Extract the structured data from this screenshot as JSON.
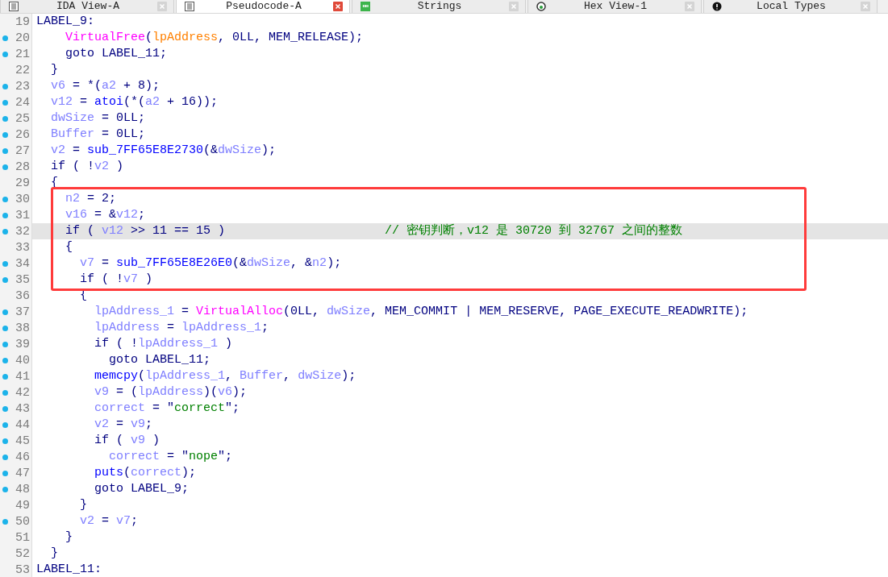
{
  "tabs": [
    {
      "label": "IDA View-A",
      "selected": false
    },
    {
      "label": "Pseudocode-A",
      "selected": true
    },
    {
      "label": "Strings",
      "selected": false
    },
    {
      "label": "Hex View-1",
      "selected": false
    },
    {
      "label": "Local Types",
      "selected": false
    }
  ],
  "code": {
    "lines": [
      {
        "number": "19",
        "breakpoint": false,
        "highlighted": false,
        "segments": [
          {
            "kind": "plain",
            "text": "LABEL_9:"
          }
        ]
      },
      {
        "number": "20",
        "breakpoint": true,
        "highlighted": false,
        "segments": [
          {
            "kind": "import",
            "text": "    VirtualFree"
          },
          {
            "kind": "plain",
            "text": "("
          },
          {
            "kind": "arg",
            "text": "lpAddress"
          },
          {
            "kind": "plain",
            "text": ", 0LL, MEM_RELEASE);"
          }
        ]
      },
      {
        "number": "21",
        "breakpoint": true,
        "highlighted": false,
        "segments": [
          {
            "kind": "plain",
            "text": "    goto LABEL_11;"
          }
        ]
      },
      {
        "number": "22",
        "breakpoint": false,
        "highlighted": false,
        "segments": [
          {
            "kind": "plain",
            "text": "  }"
          }
        ]
      },
      {
        "number": "23",
        "breakpoint": true,
        "highlighted": false,
        "segments": [
          {
            "kind": "var",
            "text": "  v6"
          },
          {
            "kind": "plain",
            "text": " = *("
          },
          {
            "kind": "var",
            "text": "a2"
          },
          {
            "kind": "plain",
            "text": " + 8);"
          }
        ]
      },
      {
        "number": "24",
        "breakpoint": true,
        "highlighted": false,
        "segments": [
          {
            "kind": "var",
            "text": "  v12"
          },
          {
            "kind": "plain",
            "text": " = "
          },
          {
            "kind": "func",
            "text": "atoi"
          },
          {
            "kind": "plain",
            "text": "(*("
          },
          {
            "kind": "var",
            "text": "a2"
          },
          {
            "kind": "plain",
            "text": " + 16));"
          }
        ]
      },
      {
        "number": "25",
        "breakpoint": true,
        "highlighted": false,
        "segments": [
          {
            "kind": "var",
            "text": "  dwSize"
          },
          {
            "kind": "plain",
            "text": " = 0LL;"
          }
        ]
      },
      {
        "number": "26",
        "breakpoint": true,
        "highlighted": false,
        "segments": [
          {
            "kind": "var",
            "text": "  Buffer"
          },
          {
            "kind": "plain",
            "text": " = 0LL;"
          }
        ]
      },
      {
        "number": "27",
        "breakpoint": true,
        "highlighted": false,
        "segments": [
          {
            "kind": "var",
            "text": "  v2"
          },
          {
            "kind": "plain",
            "text": " = "
          },
          {
            "kind": "func",
            "text": "sub_7FF65E8E2730"
          },
          {
            "kind": "plain",
            "text": "(&"
          },
          {
            "kind": "var",
            "text": "dwSize"
          },
          {
            "kind": "plain",
            "text": ");"
          }
        ]
      },
      {
        "number": "28",
        "breakpoint": true,
        "highlighted": false,
        "segments": [
          {
            "kind": "plain",
            "text": "  if ( !"
          },
          {
            "kind": "var",
            "text": "v2"
          },
          {
            "kind": "plain",
            "text": " )"
          }
        ]
      },
      {
        "number": "29",
        "breakpoint": false,
        "highlighted": false,
        "segments": [
          {
            "kind": "plain",
            "text": "  {"
          }
        ]
      },
      {
        "number": "30",
        "breakpoint": true,
        "highlighted": false,
        "segments": [
          {
            "kind": "var",
            "text": "    n2"
          },
          {
            "kind": "plain",
            "text": " = 2;"
          }
        ]
      },
      {
        "number": "31",
        "breakpoint": true,
        "highlighted": false,
        "segments": [
          {
            "kind": "var",
            "text": "    v16"
          },
          {
            "kind": "plain",
            "text": " = &"
          },
          {
            "kind": "var",
            "text": "v12"
          },
          {
            "kind": "plain",
            "text": ";"
          }
        ]
      },
      {
        "number": "32",
        "breakpoint": true,
        "highlighted": true,
        "segments": [
          {
            "kind": "plain",
            "text": "    if ( "
          },
          {
            "kind": "var",
            "text": "v12"
          },
          {
            "kind": "plain",
            "text": " >> 11 == 15 )                      "
          },
          {
            "kind": "comment",
            "text": "// 密钥判断，v12 是 30720 到 32767 之间的整数"
          }
        ]
      },
      {
        "number": "33",
        "breakpoint": false,
        "highlighted": false,
        "segments": [
          {
            "kind": "plain",
            "text": "    {"
          }
        ]
      },
      {
        "number": "34",
        "breakpoint": true,
        "highlighted": false,
        "segments": [
          {
            "kind": "var",
            "text": "      v7"
          },
          {
            "kind": "plain",
            "text": " = "
          },
          {
            "kind": "func",
            "text": "sub_7FF65E8E26E0"
          },
          {
            "kind": "plain",
            "text": "(&"
          },
          {
            "kind": "var",
            "text": "dwSize"
          },
          {
            "kind": "plain",
            "text": ", &"
          },
          {
            "kind": "var",
            "text": "n2"
          },
          {
            "kind": "plain",
            "text": ");"
          }
        ]
      },
      {
        "number": "35",
        "breakpoint": true,
        "highlighted": false,
        "segments": [
          {
            "kind": "plain",
            "text": "      if ( !"
          },
          {
            "kind": "var",
            "text": "v7"
          },
          {
            "kind": "plain",
            "text": " )"
          }
        ]
      },
      {
        "number": "36",
        "breakpoint": false,
        "highlighted": false,
        "segments": [
          {
            "kind": "plain",
            "text": "      {"
          }
        ]
      },
      {
        "number": "37",
        "breakpoint": true,
        "highlighted": false,
        "segments": [
          {
            "kind": "var",
            "text": "        lpAddress_1"
          },
          {
            "kind": "plain",
            "text": " = "
          },
          {
            "kind": "import",
            "text": "VirtualAlloc"
          },
          {
            "kind": "plain",
            "text": "(0LL, "
          },
          {
            "kind": "var",
            "text": "dwSize"
          },
          {
            "kind": "plain",
            "text": ", MEM_COMMIT | MEM_RESERVE, PAGE_EXECUTE_READWRITE);"
          }
        ]
      },
      {
        "number": "38",
        "breakpoint": true,
        "highlighted": false,
        "segments": [
          {
            "kind": "var",
            "text": "        lpAddress"
          },
          {
            "kind": "plain",
            "text": " = "
          },
          {
            "kind": "var",
            "text": "lpAddress_1"
          },
          {
            "kind": "plain",
            "text": ";"
          }
        ]
      },
      {
        "number": "39",
        "breakpoint": true,
        "highlighted": false,
        "segments": [
          {
            "kind": "plain",
            "text": "        if ( !"
          },
          {
            "kind": "var",
            "text": "lpAddress_1"
          },
          {
            "kind": "plain",
            "text": " )"
          }
        ]
      },
      {
        "number": "40",
        "breakpoint": true,
        "highlighted": false,
        "segments": [
          {
            "kind": "plain",
            "text": "          goto LABEL_11;"
          }
        ]
      },
      {
        "number": "41",
        "breakpoint": true,
        "highlighted": false,
        "segments": [
          {
            "kind": "func",
            "text": "        memcpy"
          },
          {
            "kind": "plain",
            "text": "("
          },
          {
            "kind": "var",
            "text": "lpAddress_1"
          },
          {
            "kind": "plain",
            "text": ", "
          },
          {
            "kind": "var",
            "text": "Buffer"
          },
          {
            "kind": "plain",
            "text": ", "
          },
          {
            "kind": "var",
            "text": "dwSize"
          },
          {
            "kind": "plain",
            "text": ");"
          }
        ]
      },
      {
        "number": "42",
        "breakpoint": true,
        "highlighted": false,
        "segments": [
          {
            "kind": "var",
            "text": "        v9"
          },
          {
            "kind": "plain",
            "text": " = ("
          },
          {
            "kind": "var",
            "text": "lpAddress"
          },
          {
            "kind": "plain",
            "text": ")("
          },
          {
            "kind": "var",
            "text": "v6"
          },
          {
            "kind": "plain",
            "text": ");"
          }
        ]
      },
      {
        "number": "43",
        "breakpoint": true,
        "highlighted": false,
        "segments": [
          {
            "kind": "var",
            "text": "        correct"
          },
          {
            "kind": "plain",
            "text": " = \""
          },
          {
            "kind": "string",
            "text": "correct"
          },
          {
            "kind": "plain",
            "text": "\";"
          }
        ]
      },
      {
        "number": "44",
        "breakpoint": true,
        "highlighted": false,
        "segments": [
          {
            "kind": "var",
            "text": "        v2"
          },
          {
            "kind": "plain",
            "text": " = "
          },
          {
            "kind": "var",
            "text": "v9"
          },
          {
            "kind": "plain",
            "text": ";"
          }
        ]
      },
      {
        "number": "45",
        "breakpoint": true,
        "highlighted": false,
        "segments": [
          {
            "kind": "plain",
            "text": "        if ( "
          },
          {
            "kind": "var",
            "text": "v9"
          },
          {
            "kind": "plain",
            "text": " )"
          }
        ]
      },
      {
        "number": "46",
        "breakpoint": true,
        "highlighted": false,
        "segments": [
          {
            "kind": "var",
            "text": "          correct"
          },
          {
            "kind": "plain",
            "text": " = \""
          },
          {
            "kind": "string",
            "text": "nope"
          },
          {
            "kind": "plain",
            "text": "\";"
          }
        ]
      },
      {
        "number": "47",
        "breakpoint": true,
        "highlighted": false,
        "segments": [
          {
            "kind": "func",
            "text": "        puts"
          },
          {
            "kind": "plain",
            "text": "("
          },
          {
            "kind": "var",
            "text": "correct"
          },
          {
            "kind": "plain",
            "text": ");"
          }
        ]
      },
      {
        "number": "48",
        "breakpoint": true,
        "highlighted": false,
        "segments": [
          {
            "kind": "plain",
            "text": "        goto LABEL_9;"
          }
        ]
      },
      {
        "number": "49",
        "breakpoint": false,
        "highlighted": false,
        "segments": [
          {
            "kind": "plain",
            "text": "      }"
          }
        ]
      },
      {
        "number": "50",
        "breakpoint": true,
        "highlighted": false,
        "segments": [
          {
            "kind": "var",
            "text": "      v2"
          },
          {
            "kind": "plain",
            "text": " = "
          },
          {
            "kind": "var",
            "text": "v7"
          },
          {
            "kind": "plain",
            "text": ";"
          }
        ]
      },
      {
        "number": "51",
        "breakpoint": false,
        "highlighted": false,
        "segments": [
          {
            "kind": "plain",
            "text": "    }"
          }
        ]
      },
      {
        "number": "52",
        "breakpoint": false,
        "highlighted": false,
        "segments": [
          {
            "kind": "plain",
            "text": "  }"
          }
        ]
      },
      {
        "number": "53",
        "breakpoint": false,
        "highlighted": false,
        "segments": [
          {
            "kind": "plain",
            "text": "LABEL_11:"
          }
        ]
      }
    ]
  }
}
